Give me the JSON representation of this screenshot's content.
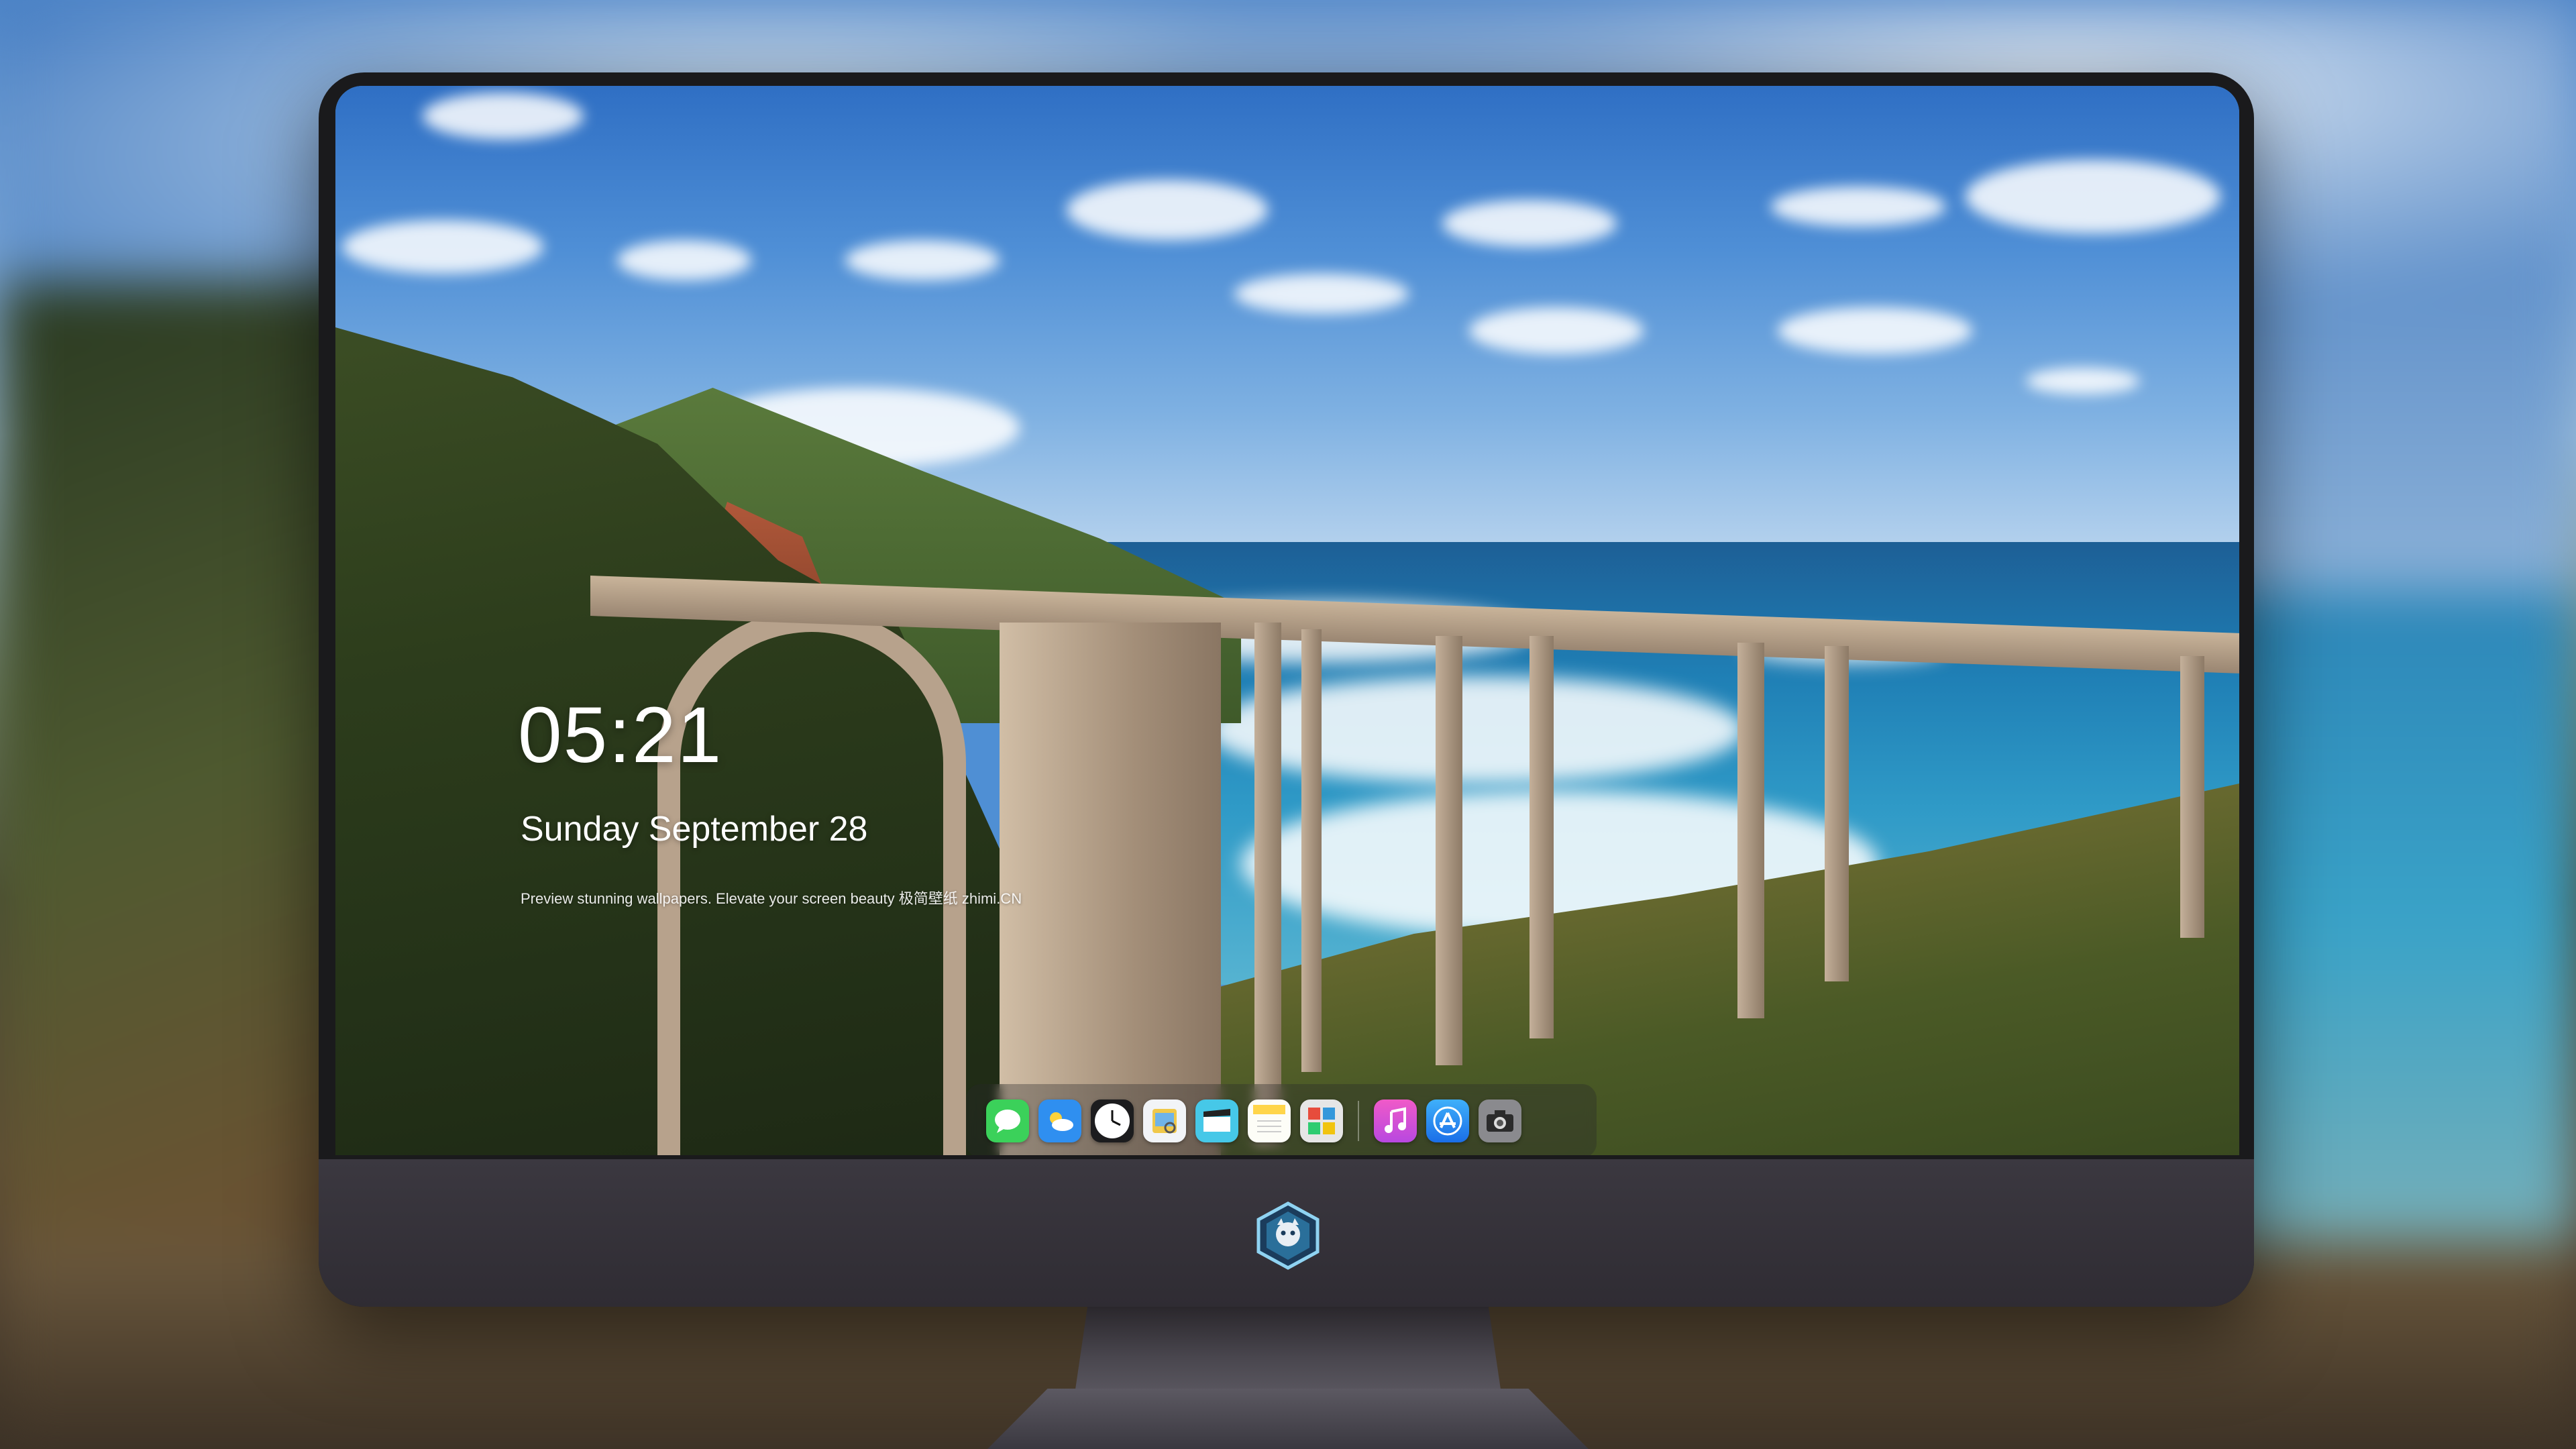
{
  "lockscreen": {
    "time": "05:21",
    "date": "Sunday September  28",
    "tagline": "Preview stunning wallpapers. Elevate your screen beauty 极简壁纸 zhimi.CN"
  },
  "dock": {
    "apps": [
      {
        "name": "messages-icon",
        "color": "#3bd15a"
      },
      {
        "name": "weather-icon",
        "color": "#2f8ff0"
      },
      {
        "name": "clock-icon",
        "color": "#f2f2f2"
      },
      {
        "name": "preview-icon",
        "color": "#f0c84a"
      },
      {
        "name": "clips-icon",
        "color": "#46c8e8"
      },
      {
        "name": "notes-icon",
        "color": "#ffd54a"
      },
      {
        "name": "photos-gallery-icon",
        "color": "#e6e6e6"
      },
      {
        "name": "itunes-icon",
        "color": "#d65ad8"
      },
      {
        "name": "app-store-icon",
        "color": "#2b8af2"
      },
      {
        "name": "camera-icon",
        "color": "#7a7a7a"
      }
    ]
  },
  "colors": {
    "monitor_frame": "#1a1a1c",
    "chin": "#35323a",
    "clock_text": "#ffffff"
  }
}
